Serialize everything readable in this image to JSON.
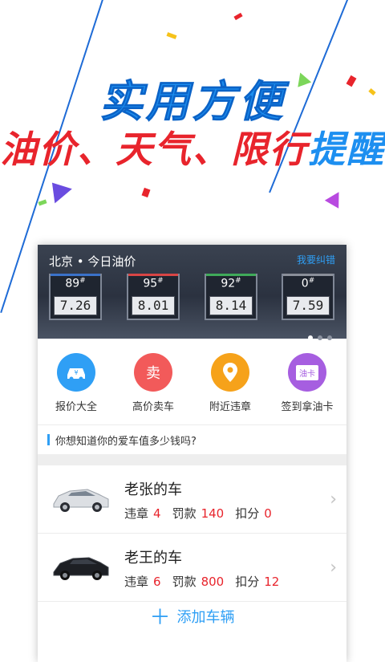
{
  "hero": {
    "title": "实用方便",
    "subtitle_red": "油价、天气、限行",
    "subtitle_blue": "提醒"
  },
  "oil_panel": {
    "city": "北京 • 今日油价",
    "correction_link": "我要纠错",
    "prices": [
      {
        "grade": "89",
        "price": "7.26",
        "color": "#3a72c9"
      },
      {
        "grade": "95",
        "price": "8.01",
        "color": "#d84545"
      },
      {
        "grade": "92",
        "price": "8.14",
        "color": "#3faa5a"
      },
      {
        "grade": "0",
        "price": "7.59",
        "color": "#8a8f99"
      }
    ],
    "pages": 3,
    "current_page": 1
  },
  "features": [
    {
      "label": "报价大全",
      "icon": "car-price-icon",
      "glyph": "¥",
      "color": "#2f9ff5"
    },
    {
      "label": "高价卖车",
      "icon": "sell-icon",
      "glyph": "卖",
      "color": "#f25a5a"
    },
    {
      "label": "附近违章",
      "icon": "location-pin-icon",
      "glyph": "●",
      "color": "#f6a21a"
    },
    {
      "label": "签到拿油卡",
      "icon": "fuel-card-icon",
      "glyph": "油卡",
      "color": "#a65ee0"
    }
  ],
  "hint": {
    "text": "你想知道你的爱车值多少钱吗?"
  },
  "cars": [
    {
      "name": "老张的车",
      "violations_label": "违章",
      "violations": "4",
      "fine_label": "罚款",
      "fine": "140",
      "points_label": "扣分",
      "points": "0",
      "body_color": "#dcdfe3"
    },
    {
      "name": "老王的车",
      "violations_label": "违章",
      "violations": "6",
      "fine_label": "罚款",
      "fine": "800",
      "points_label": "扣分",
      "points": "12",
      "body_color": "#1d1f24"
    }
  ],
  "add_vehicle": {
    "label": "添加车辆",
    "icon": "plus-icon"
  }
}
